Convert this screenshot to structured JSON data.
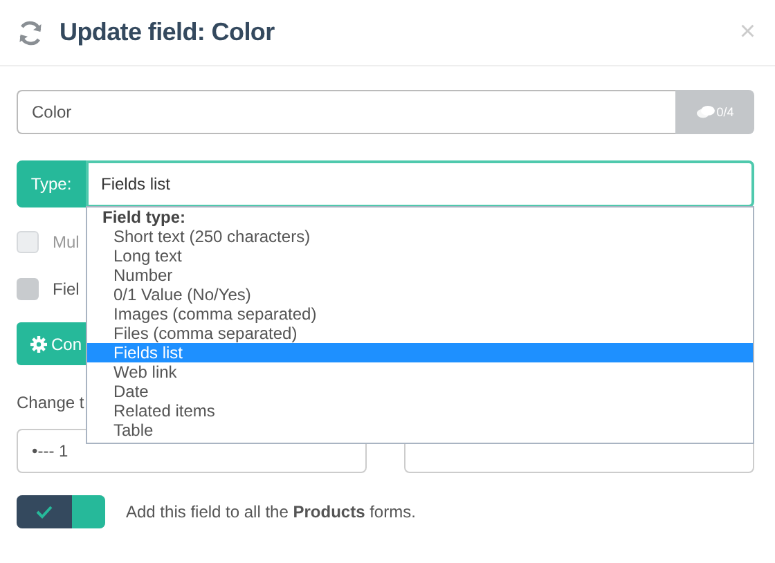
{
  "dialog": {
    "title": "Update field: Color",
    "close": "×"
  },
  "name_field": {
    "value": "Color",
    "counter": "0/4"
  },
  "type_field": {
    "label": "Type:",
    "value": "Fields list"
  },
  "dropdown": {
    "group": "Field type:",
    "options": [
      {
        "label": "Short text (250 characters)",
        "selected": false
      },
      {
        "label": "Long text",
        "selected": false
      },
      {
        "label": "Number",
        "selected": false
      },
      {
        "label": "0/1 Value (No/Yes)",
        "selected": false
      },
      {
        "label": "Images (comma separated)",
        "selected": false
      },
      {
        "label": "Files (comma separated)",
        "selected": false
      },
      {
        "label": "Fields list",
        "selected": true
      },
      {
        "label": "Web link",
        "selected": false
      },
      {
        "label": "Date",
        "selected": false
      },
      {
        "label": "Related items",
        "selected": false
      },
      {
        "label": "Table",
        "selected": false
      }
    ]
  },
  "checkboxes": [
    {
      "label": "Mul",
      "checked": false,
      "disabled": true
    },
    {
      "label": "Fiel",
      "checked": false,
      "disabled": false
    }
  ],
  "config_button": {
    "label": "Con"
  },
  "position_label": "Change t",
  "position_select": {
    "value": "•--- 1"
  },
  "toggle": {
    "on": true,
    "text": "Add this field to all the **Products** forms."
  }
}
